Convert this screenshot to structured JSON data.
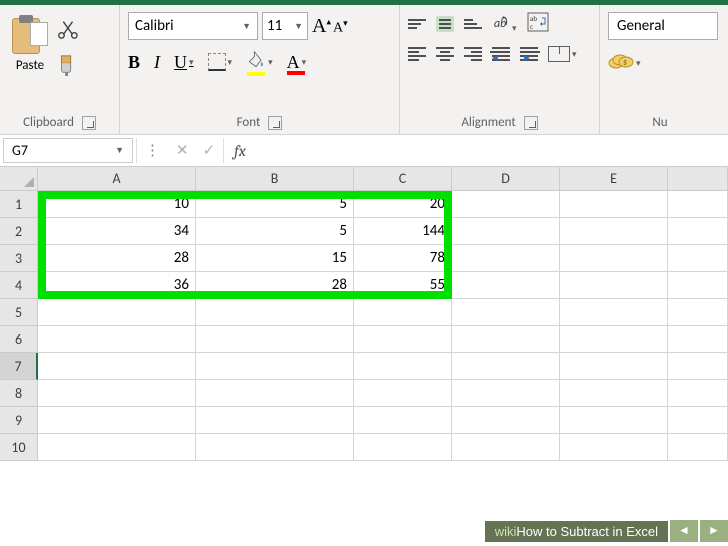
{
  "ribbon": {
    "clipboard": {
      "label": "Clipboard",
      "paste": "Paste"
    },
    "font": {
      "label": "Font",
      "name": "Calibri",
      "size": "11",
      "bold": "B",
      "italic": "I",
      "underline": "U",
      "font_color_letter": "A"
    },
    "alignment": {
      "label": "Alignment"
    },
    "number": {
      "label": "Nu",
      "format": "General"
    }
  },
  "formula_bar": {
    "name_box": "G7",
    "fx": "fx"
  },
  "columns": [
    "A",
    "B",
    "C",
    "D",
    "E"
  ],
  "rows": [
    "1",
    "2",
    "3",
    "4",
    "5",
    "6",
    "7",
    "8",
    "9",
    "10"
  ],
  "selected_row": "7",
  "cells": {
    "A1": "10",
    "B1": "5",
    "C1": "20",
    "A2": "34",
    "B2": "5",
    "C2": "144",
    "A3": "28",
    "B3": "15",
    "C3": "78",
    "A4": "36",
    "B4": "28",
    "C4": "55"
  },
  "watermark": {
    "prefix": "wiki",
    "text": "How to Subtract in Excel"
  }
}
